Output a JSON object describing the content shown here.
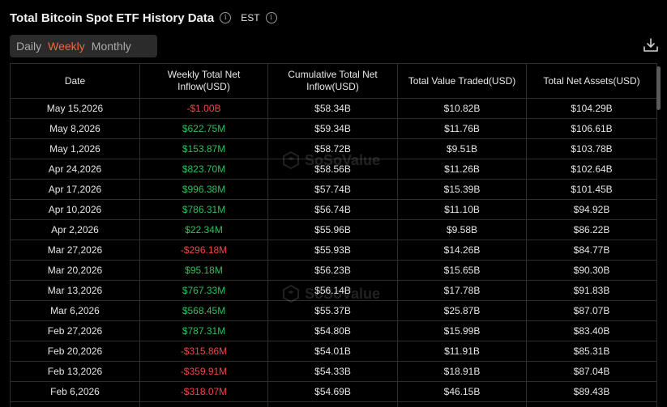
{
  "header": {
    "title": "Total Bitcoin Spot ETF History Data",
    "timezone": "EST"
  },
  "toggle": {
    "options": [
      "Daily",
      "Weekly",
      "Monthly"
    ],
    "active": "Weekly",
    "active_color": "#f0663f"
  },
  "watermark": "SoSoValue",
  "table": {
    "columns": [
      "Date",
      "Weekly Total Net Inflow(USD)",
      "Cumulative Total Net Inflow(USD)",
      "Total Value Traded(USD)",
      "Total Net Assets(USD)"
    ],
    "rows": [
      {
        "date": "May 15,2026",
        "weekly": "-$1.00B",
        "cumulative": "$58.34B",
        "traded": "$10.82B",
        "assets": "$104.29B"
      },
      {
        "date": "May 8,2026",
        "weekly": "$622.75M",
        "cumulative": "$59.34B",
        "traded": "$11.76B",
        "assets": "$106.61B"
      },
      {
        "date": "May 1,2026",
        "weekly": "$153.87M",
        "cumulative": "$58.72B",
        "traded": "$9.51B",
        "assets": "$103.78B"
      },
      {
        "date": "Apr 24,2026",
        "weekly": "$823.70M",
        "cumulative": "$58.56B",
        "traded": "$11.26B",
        "assets": "$102.64B"
      },
      {
        "date": "Apr 17,2026",
        "weekly": "$996.38M",
        "cumulative": "$57.74B",
        "traded": "$15.39B",
        "assets": "$101.45B"
      },
      {
        "date": "Apr 10,2026",
        "weekly": "$786.31M",
        "cumulative": "$56.74B",
        "traded": "$11.10B",
        "assets": "$94.92B"
      },
      {
        "date": "Apr 2,2026",
        "weekly": "$22.34M",
        "cumulative": "$55.96B",
        "traded": "$9.58B",
        "assets": "$86.22B"
      },
      {
        "date": "Mar 27,2026",
        "weekly": "-$296.18M",
        "cumulative": "$55.93B",
        "traded": "$14.26B",
        "assets": "$84.77B"
      },
      {
        "date": "Mar 20,2026",
        "weekly": "$95.18M",
        "cumulative": "$56.23B",
        "traded": "$15.65B",
        "assets": "$90.30B"
      },
      {
        "date": "Mar 13,2026",
        "weekly": "$767.33M",
        "cumulative": "$56.14B",
        "traded": "$17.78B",
        "assets": "$91.83B"
      },
      {
        "date": "Mar 6,2026",
        "weekly": "$568.45M",
        "cumulative": "$55.37B",
        "traded": "$25.87B",
        "assets": "$87.07B"
      },
      {
        "date": "Feb 27,2026",
        "weekly": "$787.31M",
        "cumulative": "$54.80B",
        "traded": "$15.99B",
        "assets": "$83.40B"
      },
      {
        "date": "Feb 20,2026",
        "weekly": "-$315.86M",
        "cumulative": "$54.01B",
        "traded": "$11.91B",
        "assets": "$85.31B"
      },
      {
        "date": "Feb 13,2026",
        "weekly": "-$359.91M",
        "cumulative": "$54.33B",
        "traded": "$18.91B",
        "assets": "$87.04B"
      },
      {
        "date": "Feb 6,2026",
        "weekly": "-$318.07M",
        "cumulative": "$54.69B",
        "traded": "$46.15B",
        "assets": "$89.43B"
      },
      {
        "date": "",
        "weekly": "",
        "cumulative": "",
        "traded": "",
        "assets": ""
      }
    ]
  },
  "colors": {
    "positive": "#2fbf5b",
    "negative": "#f04747"
  }
}
